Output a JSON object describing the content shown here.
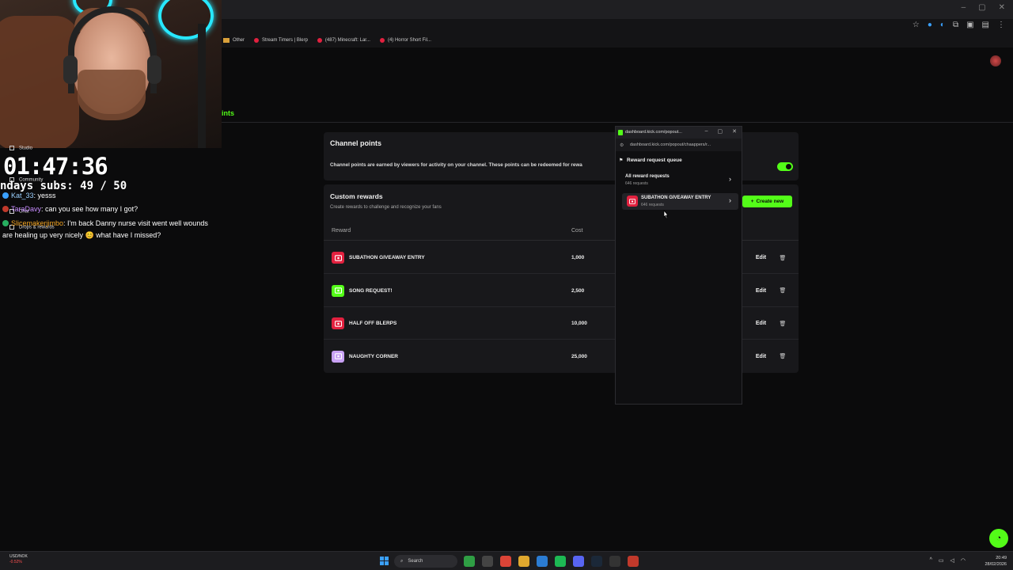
{
  "browser": {
    "bookmarks": [
      {
        "label": "Other",
        "kind": "folder"
      },
      {
        "label": "Stream Timers | Blerp",
        "kind": "site"
      },
      {
        "label": "(487) Minecraft: Lar...",
        "kind": "youtube"
      },
      {
        "label": "(4) Horror Short Fil...",
        "kind": "youtube"
      }
    ]
  },
  "page": {
    "tab_label": "ints",
    "channel_points": {
      "title": "Channel points",
      "description": "Channel points are earned by viewers for activity on your channel. These points can be redeemed for rewa",
      "enabled": true
    },
    "custom_rewards": {
      "title": "Custom rewards",
      "subtitle": "Create rewards to challenge and recognize your fans",
      "create_label": "Create new",
      "col_reward": "Reward",
      "col_cost": "Cost",
      "edit_label": "Edit",
      "rows": [
        {
          "name": "SUBATHON GIVEAWAY ENTRY",
          "cost": "1,000",
          "color": "#e2213f"
        },
        {
          "name": "SONG REQUEST!",
          "cost": "2,500",
          "color": "#53fc18"
        },
        {
          "name": "HALF OFF BLERPS",
          "cost": "10,000",
          "color": "#e2213f"
        },
        {
          "name": "NAUGHTY CORNER",
          "cost": "25,000",
          "color": "#c9a2f5"
        }
      ]
    }
  },
  "popout": {
    "title": "dashboard.kick.com/popout...",
    "url": "dashboard.kick.com/popout/chaappers/r...",
    "section": "Reward request queue",
    "items": [
      {
        "name": "All reward requests",
        "count": "646 requests"
      },
      {
        "name": "SUBATHON GIVEAWAY ENTRY",
        "count": "646 requests"
      }
    ]
  },
  "overlay": {
    "timer": "01:47:36",
    "subs": "ndays subs:  49 / 50",
    "menu": [
      "Studio",
      "Community",
      "Chat",
      "Drops & rewards"
    ],
    "chat": [
      {
        "user": "Kat_33",
        "message": ": yesss"
      },
      {
        "user": "TaraDavy",
        "message": ": can you see how many I got?"
      },
      {
        "user": "Slicemakerjimbo",
        "message": ": I'm back Danny nurse visit went well wounds are healing up very nicely 😊 what have I missed?"
      }
    ]
  },
  "taskbar": {
    "stock_name": "USD/NOK",
    "stock_change": "-0.52%",
    "search_label": "Search",
    "time": "20:49",
    "date": "28/02/2026"
  },
  "colors": {
    "accent": "#53fc18",
    "card": "#18181b",
    "background": "#0b0b0c"
  }
}
